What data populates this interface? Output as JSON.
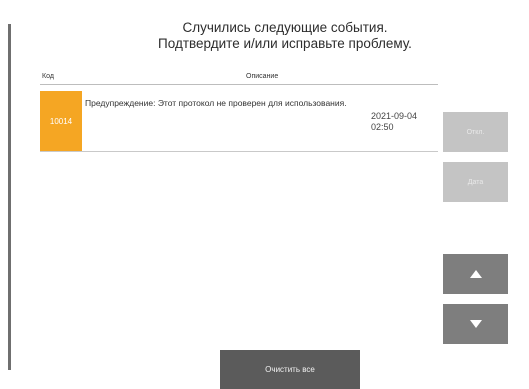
{
  "dialog": {
    "heading_line1": "Случились следующие события.",
    "heading_line2": "Подтвердите и/или исправьте проблему."
  },
  "table": {
    "columns": [
      "Код",
      "Описание"
    ],
    "rows": [
      {
        "code": "10014",
        "description": "Предупреждение: Этот протокол не проверен для использования.",
        "date": "2021-09-04",
        "time": "02:50",
        "severity_color": "#f5a623"
      }
    ]
  },
  "buttons": {
    "close_label": "Откл.",
    "back_label": "Дата",
    "up_icon": "triangle-up-icon",
    "down_icon": "triangle-down-icon",
    "clear_all_label": "Очистить все"
  }
}
